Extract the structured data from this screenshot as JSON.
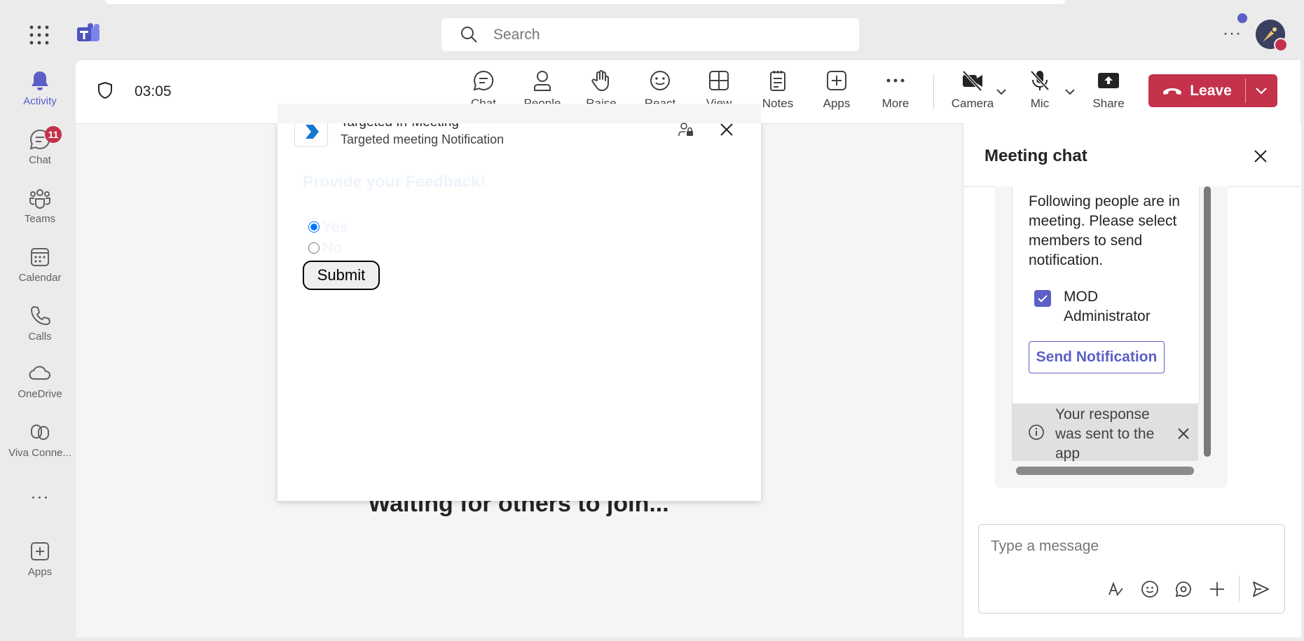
{
  "topbar": {
    "search_placeholder": "Search",
    "more_label": "···"
  },
  "rail": {
    "items": [
      {
        "label": "Activity",
        "icon": "bell-icon"
      },
      {
        "label": "Chat",
        "icon": "chat-icon",
        "badge": "11"
      },
      {
        "label": "Teams",
        "icon": "teams-icon"
      },
      {
        "label": "Calendar",
        "icon": "calendar-icon"
      },
      {
        "label": "Calls",
        "icon": "phone-icon"
      },
      {
        "label": "OneDrive",
        "icon": "cloud-icon"
      },
      {
        "label": "Viva Conne...",
        "icon": "viva-icon"
      },
      {
        "label": "Apps",
        "icon": "add-app-icon"
      }
    ],
    "more": "···"
  },
  "meeting": {
    "timer": "03:05",
    "tools": [
      {
        "label": "Chat",
        "icon": "chat-icon"
      },
      {
        "label": "People",
        "icon": "person-icon"
      },
      {
        "label": "Raise",
        "icon": "hand-icon"
      },
      {
        "label": "React",
        "icon": "smile-icon"
      },
      {
        "label": "View",
        "icon": "grid-icon"
      },
      {
        "label": "Notes",
        "icon": "notes-icon"
      },
      {
        "label": "Apps",
        "icon": "add-app-icon"
      },
      {
        "label": "More",
        "icon": "more-icon"
      }
    ],
    "devices": [
      {
        "label": "Camera",
        "icon": "camera-off-icon"
      },
      {
        "label": "Mic",
        "icon": "mic-off-icon"
      },
      {
        "label": "Share",
        "icon": "share-icon"
      }
    ],
    "leave_label": "Leave",
    "waiting_text": "Waiting for others to join..."
  },
  "popup": {
    "title": "Targeted In-Meeting",
    "subtitle": "Targeted meeting Notification",
    "heading": "Provide your Feedback!",
    "options": [
      "Yes",
      "No"
    ],
    "selected": "Yes",
    "submit_label": "Submit"
  },
  "chat_panel": {
    "title": "Meeting chat",
    "card_text": "Following people are in meeting. Please select members to send notification.",
    "member_name": "MOD Administrator",
    "member_checked": true,
    "send_label": "Send Notification",
    "response_text": "Your response was sent to the app",
    "compose_placeholder": "Type a message"
  },
  "colors": {
    "brand": "#5b5fc7",
    "leave": "#c4314b"
  }
}
